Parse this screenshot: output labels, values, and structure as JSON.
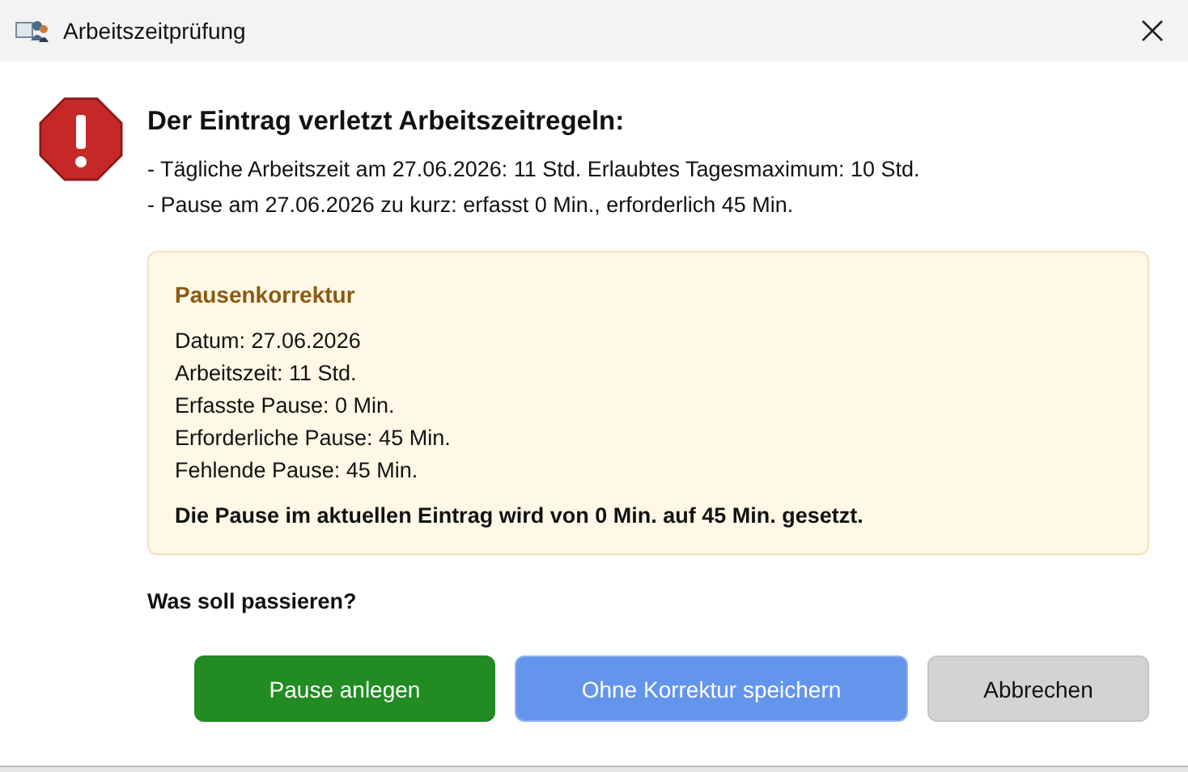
{
  "window": {
    "title": "Arbeitszeitprüfung"
  },
  "message": {
    "heading": "Der Eintrag verletzt Arbeitszeitregeln:",
    "violations": [
      "- Tägliche Arbeitszeit am 27.06.2026: 11 Std. Erlaubtes Tagesmaximum: 10 Std.",
      "- Pause am 27.06.2026 zu kurz: erfasst 0 Min., erforderlich 45 Min."
    ]
  },
  "correction": {
    "title": "Pausenkorrektur",
    "details": [
      "Datum: 27.06.2026",
      "Arbeitszeit: 11 Std.",
      "Erfasste Pause: 0 Min.",
      "Erforderliche Pause: 45 Min.",
      "Fehlende Pause: 45 Min."
    ],
    "summary": "Die Pause im aktuellen Eintrag wird von 0 Min. auf 45 Min. gesetzt."
  },
  "question": "Was soll passieren?",
  "buttons": [
    {
      "label": "Pause anlegen",
      "kind": "primary"
    },
    {
      "label": "Ohne Korrektur speichern",
      "kind": "secondary"
    },
    {
      "label": "Abbrechen",
      "kind": "cancel"
    }
  ]
}
